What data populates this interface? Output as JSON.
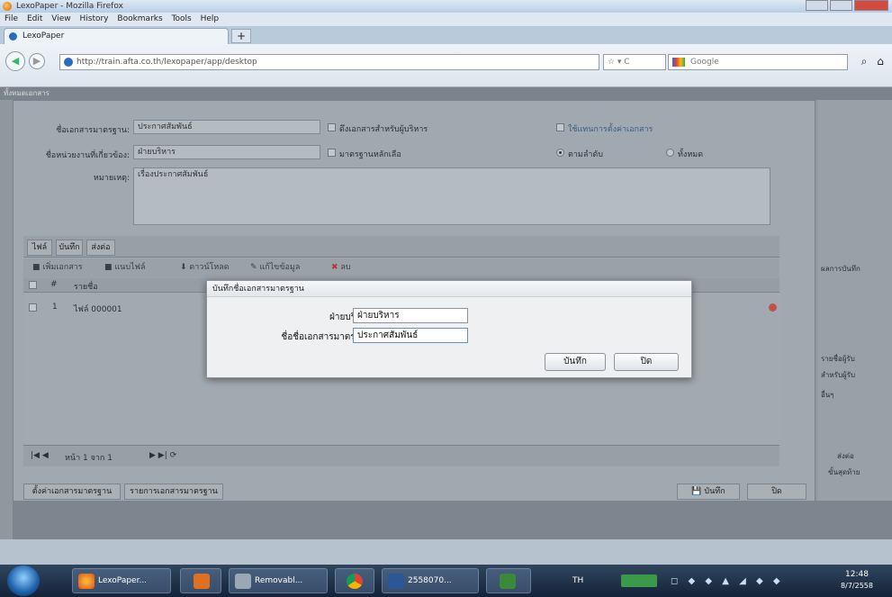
{
  "browser": {
    "window_title": "LexoPaper - Mozilla Firefox",
    "menu": [
      "File",
      "Edit",
      "View",
      "History",
      "Bookmarks",
      "Tools",
      "Help"
    ],
    "tab_title": "LexoPaper",
    "url": "http://train.afta.co.th/lexopaper/app/desktop",
    "search_placeholder": "Google"
  },
  "app": {
    "header": "ทั้งหมดเอกสาร",
    "form": {
      "doc_name_label": "ชื่อเอกสารมาตรฐาน:",
      "doc_name_value": "ประกาศสัมพันธ์",
      "unit_label": "ชื่อหน่วยงานที่เกี่ยวข้อง:",
      "unit_value": "ฝ่ายบริหาร",
      "note_label": "หมายเหตุ:",
      "note_value": "เรื่องประกาศสัมพันธ์",
      "check1_label": "ดึงเอกสารสำหรับผู้บริหาร",
      "check2_label": "มาตรฐานหลักเลือ",
      "link_label": "ใช้แทนการตั้งค่าเอกสาร",
      "radio1_label": "ตามลำดับ",
      "radio2_label": "ทั้งหมด"
    },
    "tabs": [
      "ไฟล์",
      "บันทึก",
      "ส่งต่อ"
    ],
    "toolbar": [
      "เพิ่มเอกสาร",
      "แนบไฟล์",
      "ดาวน์โหลด",
      "แก้ไขข้อมูล",
      "ลบ"
    ],
    "grid": {
      "headers": [
        "#",
        "รายชื่อ"
      ],
      "rows": [
        {
          "num": "1",
          "name": "ไฟล์ 000001"
        }
      ]
    },
    "pager": "หน้า 1 จาก 1",
    "bottom_buttons": [
      "ตั้งค่าเอกสารมาตรฐาน",
      "รายการเอกสารมาตรฐาน"
    ],
    "save": "บันทึก",
    "close": "ปิด",
    "right_labels": [
      "ผลการบันทึก",
      "รายชื่อผู้รับ",
      "สำหรับผู้รับ",
      "อื่นๆ",
      "ส่งต่อ",
      "ขั้นสุดท้าย"
    ]
  },
  "dialog": {
    "title": "บันทึกชื่อเอกสารมาตรฐาน",
    "dept_label": "ฝ่ายบริหาร:",
    "dept_value": "ฝ่ายบริหาร",
    "docname_label": "ชื่อชื่อเอกสารมาตรฐาน:",
    "docname_value": "ประกาศสัมพันธ์",
    "save_btn": "บันทึก",
    "close_btn": "ปิด"
  },
  "taskbar": {
    "apps": [
      "LexoPaper...",
      "Removabl...",
      "2558070..."
    ],
    "lang": "TH",
    "clock_time": "12:48",
    "clock_date": "8/7/2558"
  },
  "colors": {
    "dialog_bg": "#eef0f2",
    "taskbar": "#1d3049",
    "overlay": "#8f989f"
  }
}
